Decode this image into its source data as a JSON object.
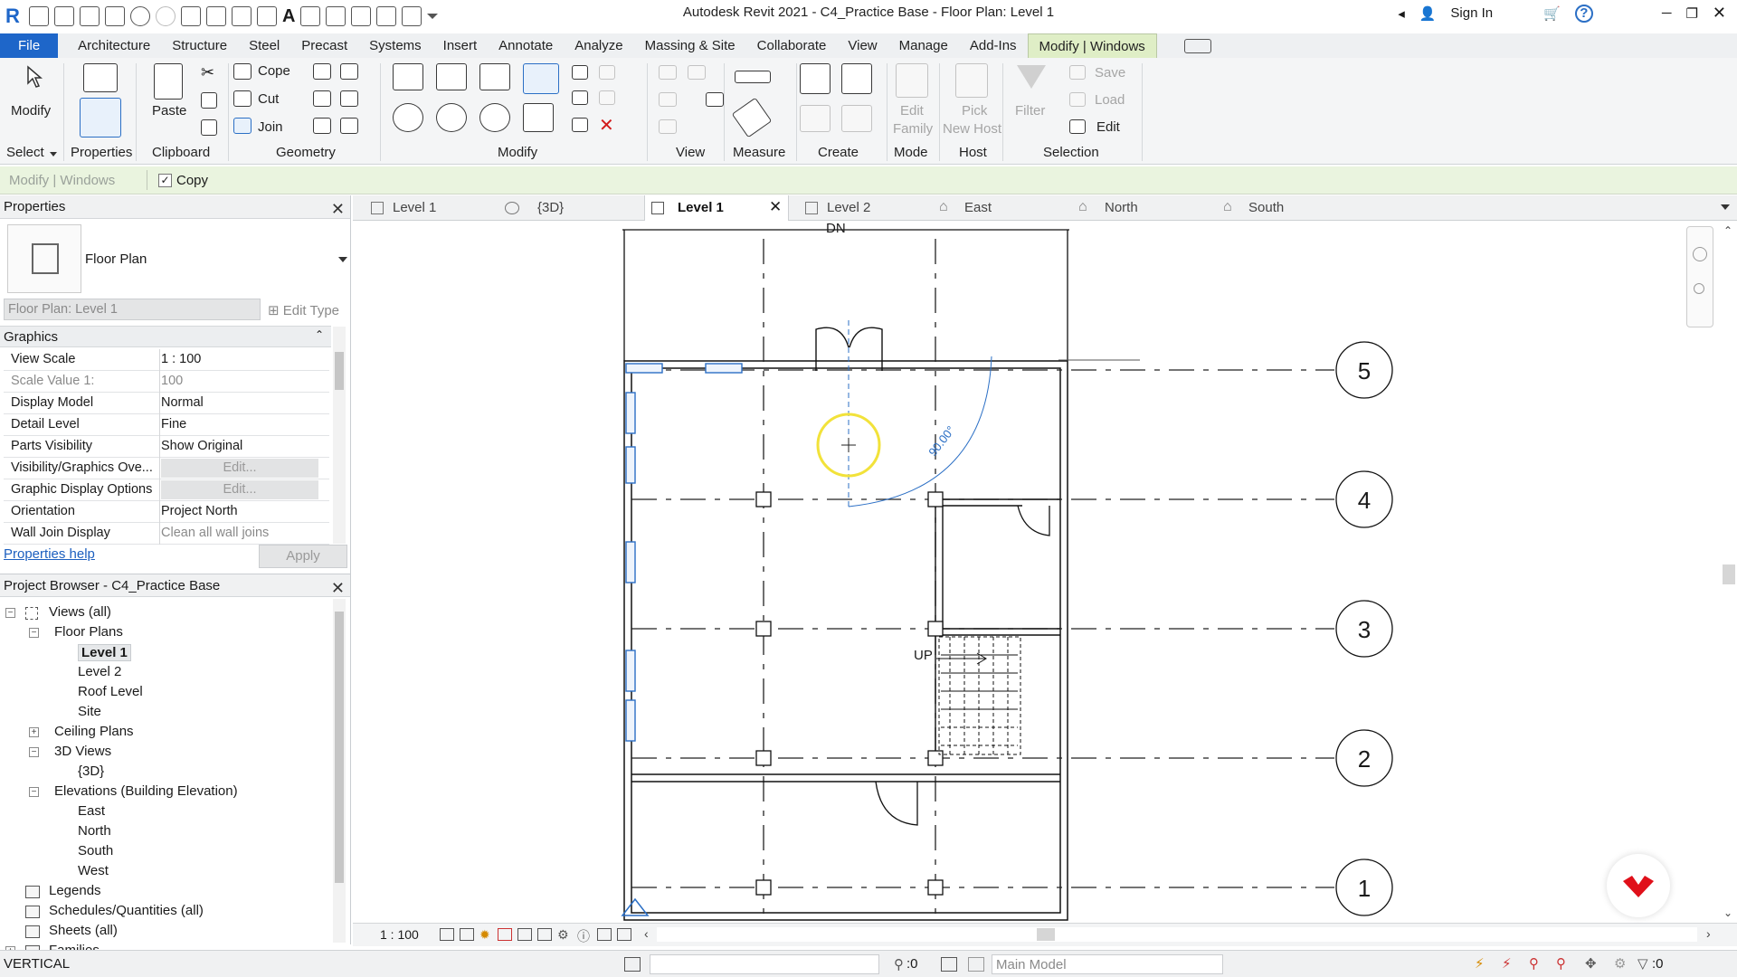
{
  "titlebar": {
    "app_title": "Autodesk Revit 2021 - C4_Practice Base - Floor Plan: Level 1",
    "sign_in": "Sign In"
  },
  "ribbon_tabs": [
    "File",
    "Architecture",
    "Structure",
    "Steel",
    "Precast",
    "Systems",
    "Insert",
    "Annotate",
    "Analyze",
    "Massing & Site",
    "Collaborate",
    "View",
    "Manage",
    "Add-Ins",
    "Modify | Windows"
  ],
  "ribbon": {
    "modify_label": "Modify",
    "paste_label": "Paste",
    "cope_label": "Cope",
    "cut_label": "Cut",
    "join_label": "Join",
    "edit_family_1": "Edit",
    "edit_family_2": "Family",
    "pick_host_1": "Pick",
    "pick_host_2": "New Host",
    "filter_label": "Filter",
    "save_label": "Save",
    "load_label": "Load",
    "edit_label": "Edit",
    "panels": {
      "select": "Select",
      "properties": "Properties",
      "clipboard": "Clipboard",
      "geometry": "Geometry",
      "modify": "Modify",
      "view": "View",
      "measure": "Measure",
      "create": "Create",
      "mode": "Mode",
      "host": "Host",
      "selection": "Selection"
    }
  },
  "options_bar": {
    "context": "Modify | Windows",
    "copy_label": "Copy"
  },
  "properties": {
    "title": "Properties",
    "type_name": "Floor Plan",
    "instance_selector": "Floor Plan: Level 1",
    "edit_type": "Edit Type",
    "section": "Graphics",
    "rows": [
      {
        "k": "View Scale",
        "v": "1 : 100"
      },
      {
        "k": "Scale Value    1:",
        "v": "100"
      },
      {
        "k": "Display Model",
        "v": "Normal"
      },
      {
        "k": "Detail Level",
        "v": "Fine"
      },
      {
        "k": "Parts Visibility",
        "v": "Show Original"
      },
      {
        "k": "Visibility/Graphics Ove...",
        "v": "Edit..."
      },
      {
        "k": "Graphic Display Options",
        "v": "Edit..."
      },
      {
        "k": "Orientation",
        "v": "Project North"
      },
      {
        "k": "Wall Join Display",
        "v": "Clean all wall joins"
      }
    ],
    "help_link": "Properties help",
    "apply": "Apply"
  },
  "browser": {
    "title": "Project Browser - C4_Practice Base",
    "items": [
      {
        "label": "Views (all)",
        "level": 0,
        "toggle": "-"
      },
      {
        "label": "Floor Plans",
        "level": 1,
        "toggle": "-"
      },
      {
        "label": "Level 1",
        "level": 2,
        "toggle": ""
      },
      {
        "label": "Level 2",
        "level": 2,
        "toggle": ""
      },
      {
        "label": "Roof Level",
        "level": 2,
        "toggle": ""
      },
      {
        "label": "Site",
        "level": 2,
        "toggle": ""
      },
      {
        "label": "Ceiling Plans",
        "level": 1,
        "toggle": "+"
      },
      {
        "label": "3D Views",
        "level": 1,
        "toggle": "-"
      },
      {
        "label": "{3D}",
        "level": 2,
        "toggle": ""
      },
      {
        "label": "Elevations (Building Elevation)",
        "level": 1,
        "toggle": "-"
      },
      {
        "label": "East",
        "level": 2,
        "toggle": ""
      },
      {
        "label": "North",
        "level": 2,
        "toggle": ""
      },
      {
        "label": "South",
        "level": 2,
        "toggle": ""
      },
      {
        "label": "West",
        "level": 2,
        "toggle": ""
      },
      {
        "label": "Legends",
        "level": 0,
        "toggle": ""
      },
      {
        "label": "Schedules/Quantities (all)",
        "level": 0,
        "toggle": ""
      },
      {
        "label": "Sheets (all)",
        "level": 0,
        "toggle": ""
      },
      {
        "label": "Families",
        "level": 0,
        "toggle": "+"
      }
    ]
  },
  "view_tabs": [
    "Level 1",
    "{3D}",
    "Level 1",
    "Level 2",
    "East",
    "North",
    "South"
  ],
  "canvas": {
    "dn_label": "DN",
    "up_label": "UP",
    "angle_label": "90.00°",
    "grids": [
      "5",
      "4",
      "3",
      "2",
      "1"
    ]
  },
  "viewbar": {
    "scale": "1 : 100"
  },
  "statusbar": {
    "status": "VERTICAL",
    "workset_count": ":0",
    "model": "Main Model",
    "filter_count": ":0"
  },
  "colors": {
    "file_tab": "#1e66c9",
    "contextual_tab": "#dfeec6",
    "options_bar": "#eaf4df",
    "selection_blue": "#2b6fc5",
    "cursor_halo": "#f2e23a",
    "brand_red": "#e0101a"
  }
}
